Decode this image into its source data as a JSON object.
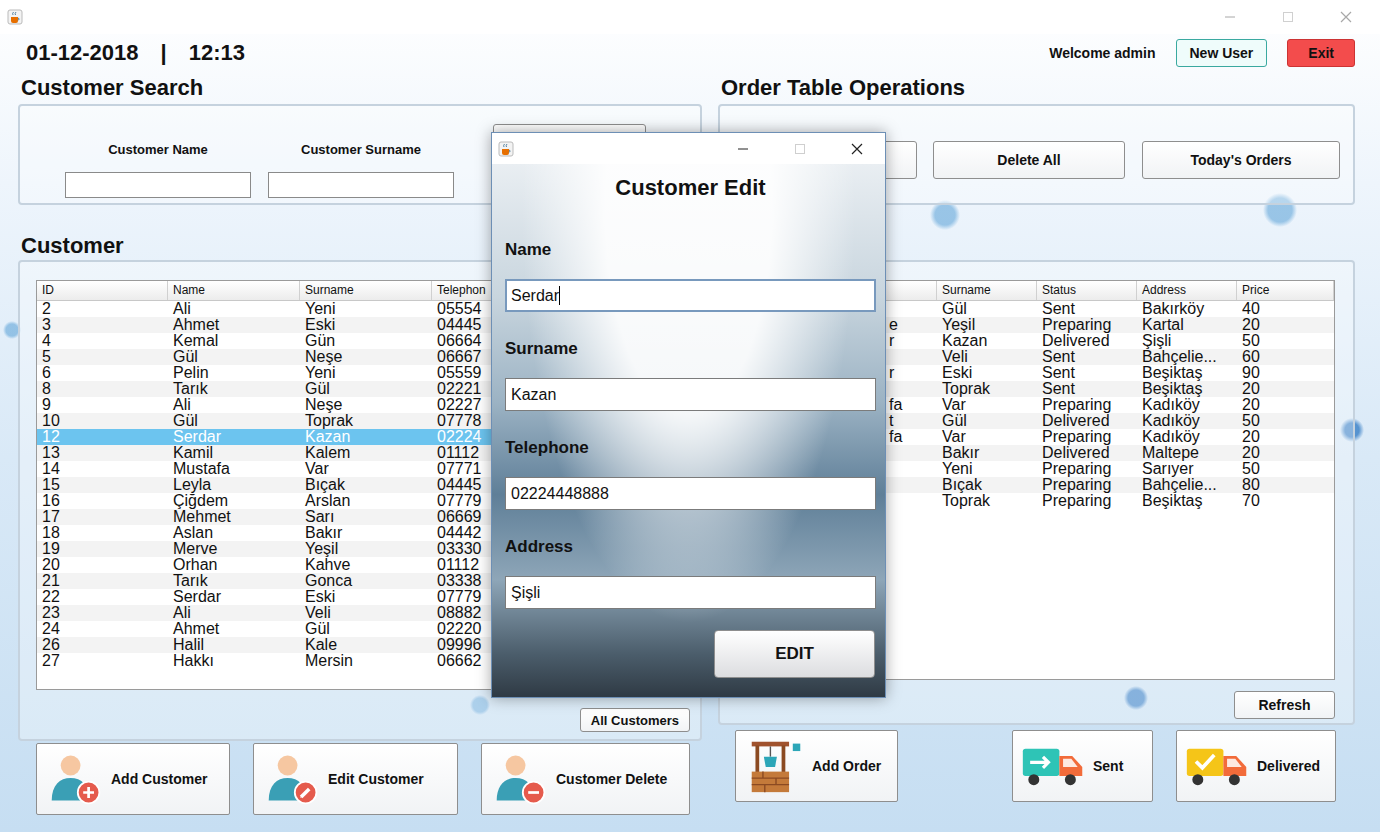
{
  "header": {
    "date": "01-12-2018",
    "separator": "|",
    "time": "12:13",
    "welcome": "Welcome admin",
    "buttons": [
      {
        "label": "New User",
        "kind": "default"
      },
      {
        "label": "Exit",
        "kind": "danger"
      }
    ]
  },
  "customer_search": {
    "title": "Customer Search",
    "fields": [
      {
        "label": "Customer Name",
        "value": ""
      },
      {
        "label": "Customer Surname",
        "value": ""
      }
    ]
  },
  "customer_table": {
    "title": "Customer",
    "columns": [
      "ID",
      "Name",
      "Surname",
      "Telephon"
    ],
    "rows": [
      {
        "cells": [
          "2",
          "Ali",
          "Yeni",
          "05554"
        ],
        "selected": false
      },
      {
        "cells": [
          "3",
          "Ahmet",
          "Eski",
          "04445"
        ],
        "selected": false
      },
      {
        "cells": [
          "4",
          "Kemal",
          "Gün",
          "06664"
        ],
        "selected": false
      },
      {
        "cells": [
          "5",
          "Gül",
          "Neşe",
          "06667"
        ],
        "selected": false
      },
      {
        "cells": [
          "6",
          "Pelin",
          "Yeni",
          "05559"
        ],
        "selected": false
      },
      {
        "cells": [
          "8",
          "Tarık",
          "Gül",
          "02221"
        ],
        "selected": false
      },
      {
        "cells": [
          "9",
          "Ali",
          "Neşe",
          "02227"
        ],
        "selected": false
      },
      {
        "cells": [
          "10",
          "Gül",
          "Toprak",
          "07778"
        ],
        "selected": false
      },
      {
        "cells": [
          "12",
          "Serdar",
          "Kazan",
          "02224"
        ],
        "selected": true
      },
      {
        "cells": [
          "13",
          "Kamil",
          "Kalem",
          "01112"
        ],
        "selected": false
      },
      {
        "cells": [
          "14",
          "Mustafa",
          "Var",
          "07771"
        ],
        "selected": false
      },
      {
        "cells": [
          "15",
          "Leyla",
          "Bıçak",
          "04445"
        ],
        "selected": false
      },
      {
        "cells": [
          "16",
          "Çiğdem",
          "Arslan",
          "07779"
        ],
        "selected": false
      },
      {
        "cells": [
          "17",
          "Mehmet",
          "Sarı",
          "06669"
        ],
        "selected": false
      },
      {
        "cells": [
          "18",
          "Aslan",
          "Bakır",
          "04442"
        ],
        "selected": false
      },
      {
        "cells": [
          "19",
          "Merve",
          "Yeşil",
          "03330"
        ],
        "selected": false
      },
      {
        "cells": [
          "20",
          "Orhan",
          "Kahve",
          "01112"
        ],
        "selected": false
      },
      {
        "cells": [
          "21",
          "Tarık",
          "Gonca",
          "03338"
        ],
        "selected": false
      },
      {
        "cells": [
          "22",
          "Serdar",
          "Eski",
          "07779"
        ],
        "selected": false
      },
      {
        "cells": [
          "23",
          "Ali",
          "Veli",
          "08882"
        ],
        "selected": false
      },
      {
        "cells": [
          "24",
          "Ahmet",
          "Gül",
          "02220"
        ],
        "selected": false
      },
      {
        "cells": [
          "26",
          "Halil",
          "Kale",
          "09996"
        ],
        "selected": false
      },
      {
        "cells": [
          "27",
          "Hakkı",
          "Mersin",
          "06662"
        ],
        "selected": false
      }
    ]
  },
  "customer_list_button": "All Customers",
  "customer_actions": [
    {
      "label": "Add Customer",
      "kind": "add"
    },
    {
      "label": "Edit Customer",
      "kind": "edit"
    },
    {
      "label": "Customer Delete",
      "kind": "delete"
    }
  ],
  "order_ops": {
    "title": "Order Table Operations",
    "buttons": [
      "Delete All",
      "Today's Orders"
    ]
  },
  "order_table": {
    "columns": [
      "Surname",
      "Status",
      "Address",
      "Price"
    ],
    "rows": [
      {
        "cells": [
          "Gül",
          "Sent",
          "Bakırköy",
          "40"
        ]
      },
      {
        "name_tail": "e",
        "cells": [
          "Yeşil",
          "Preparing",
          "Kartal",
          "20"
        ]
      },
      {
        "name_tail": "r",
        "cells": [
          "Kazan",
          "Delivered",
          "Şişli",
          "50"
        ]
      },
      {
        "cells": [
          "Veli",
          "Sent",
          "Bahçelie...",
          "60"
        ]
      },
      {
        "name_tail": "r",
        "cells": [
          "Eski",
          "Sent",
          "Beşiktaş",
          "90"
        ]
      },
      {
        "cells": [
          "Toprak",
          "Sent",
          "Beşiktaş",
          "20"
        ]
      },
      {
        "name_tail": "fa",
        "cells": [
          "Var",
          "Preparing",
          "Kadıköy",
          "20"
        ]
      },
      {
        "name_tail": "t",
        "cells": [
          "Gül",
          "Delivered",
          "Kadıköy",
          "50"
        ]
      },
      {
        "name_tail": "fa",
        "cells": [
          "Var",
          "Preparing",
          "Kadıköy",
          "20"
        ]
      },
      {
        "cells": [
          "Bakır",
          "Delivered",
          "Maltepe",
          "20"
        ]
      },
      {
        "cells": [
          "Yeni",
          "Preparing",
          "Sarıyer",
          "50"
        ]
      },
      {
        "cells": [
          "Bıçak",
          "Preparing",
          "Bahçelie...",
          "80"
        ]
      },
      {
        "cells": [
          "Toprak",
          "Preparing",
          "Beşiktaş",
          "70"
        ]
      }
    ]
  },
  "order_refresh_button": "Refresh",
  "order_actions": [
    {
      "label": "Add Order",
      "kind": "order"
    },
    {
      "label": "Sent",
      "kind": "sent"
    },
    {
      "label": "Delivered",
      "kind": "delivered"
    }
  ],
  "dialog": {
    "title": "Customer Edit",
    "fields": [
      {
        "label": "Name",
        "value": "Serdar",
        "focused": true
      },
      {
        "label": "Surname",
        "value": "Kazan",
        "focused": false
      },
      {
        "label": "Telephone",
        "value": "02224448888",
        "focused": false
      },
      {
        "label": "Address",
        "value": "Şişli",
        "focused": false
      }
    ],
    "button": "EDIT"
  }
}
